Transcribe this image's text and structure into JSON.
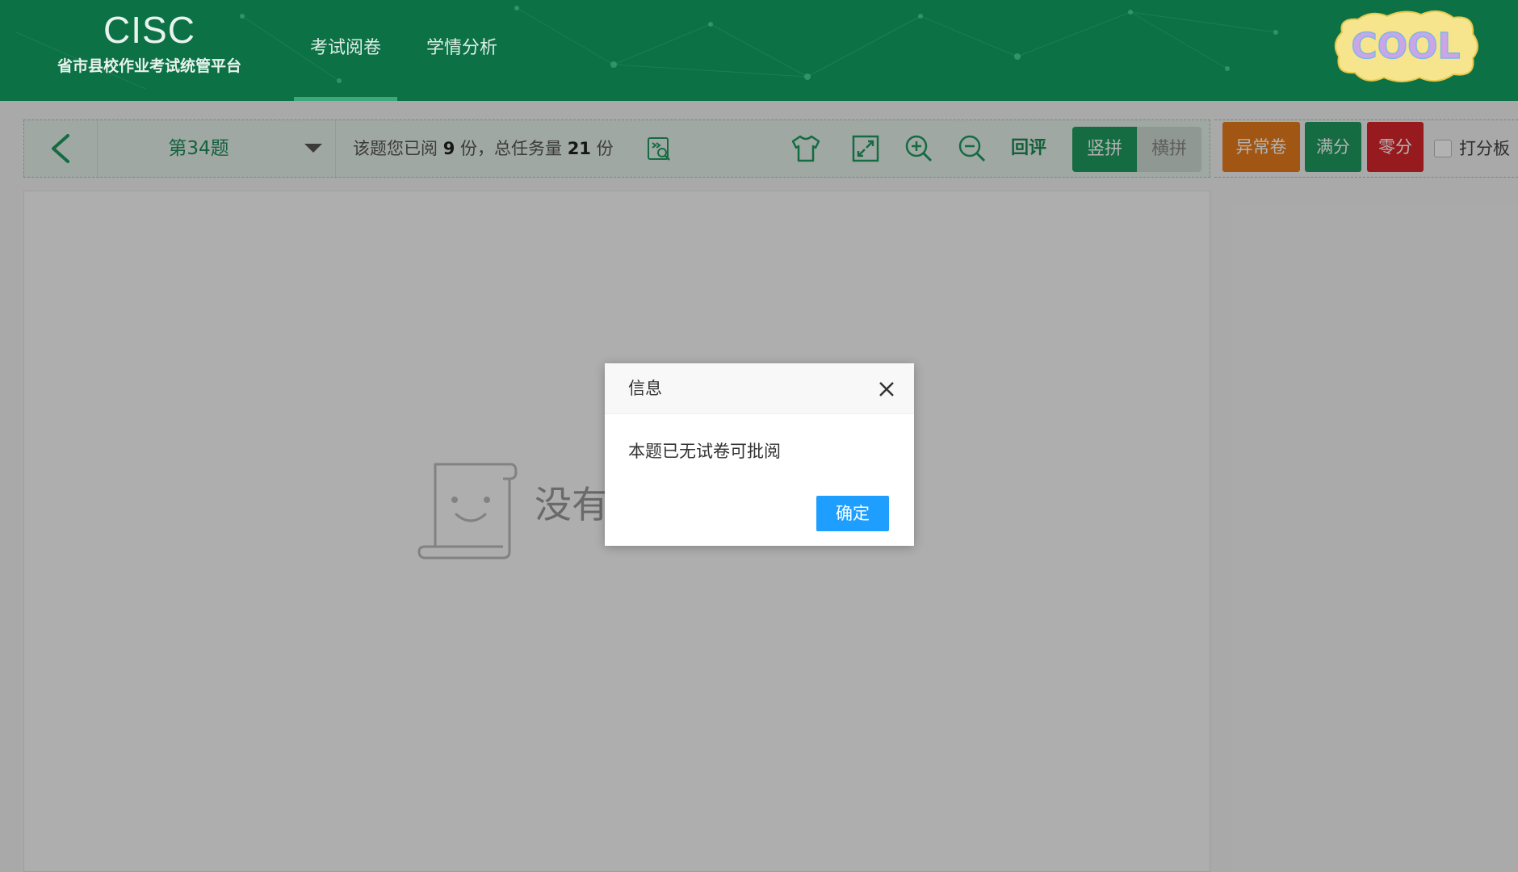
{
  "brand": {
    "title": "CISC",
    "subtitle": "省市县校作业考试统管平台"
  },
  "nav": {
    "items": [
      {
        "label": "考试阅卷",
        "active": true
      },
      {
        "label": "学情分析",
        "active": false
      }
    ]
  },
  "logo": {
    "text": "COOL"
  },
  "toolbar": {
    "question_label": "第34题",
    "progress": {
      "prefix": "该题您已阅",
      "read": "9",
      "mid": "份，总任务量",
      "total": "21",
      "suffix": "份"
    },
    "review_label": "回评",
    "vertical_label": "竖拼",
    "horizontal_label": "横拼",
    "icons": [
      "back-arrow-icon",
      "caret-down-icon",
      "search-paper-icon",
      "shirt-icon",
      "fullscreen-icon",
      "zoom-in-icon",
      "zoom-out-icon"
    ]
  },
  "score_panel": {
    "abnormal_label": "异常卷",
    "full_label": "满分",
    "zero_label": "零分",
    "pad_label": "打分板",
    "pad_checked": false
  },
  "main": {
    "empty_text": "没有"
  },
  "dialog": {
    "title": "信息",
    "message": "本题已无试卷可批阅",
    "ok_label": "确定"
  },
  "colors": {
    "header": "#0d7146",
    "primary_green": "#1f9a5f",
    "abnormal": "#e77b1c",
    "zero": "#d7262c",
    "dialog_button": "#1e9fff"
  }
}
